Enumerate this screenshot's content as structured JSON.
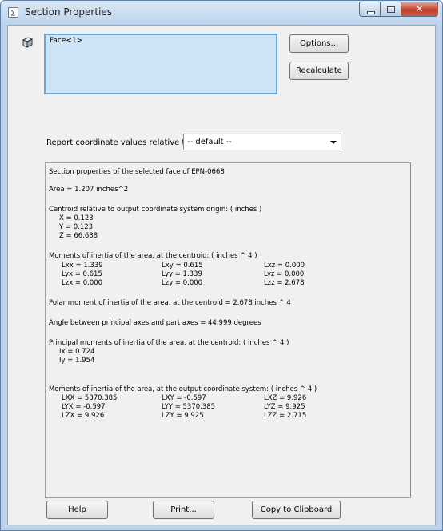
{
  "window": {
    "title": "Section Properties"
  },
  "selection": {
    "items": [
      "Face<1>"
    ]
  },
  "buttons": {
    "options": "Options...",
    "recalculate": "Recalculate",
    "help": "Help",
    "print": "Print...",
    "copy": "Copy to Clipboard"
  },
  "report": {
    "label": "Report coordinate values relative to:",
    "selected": "-- default --"
  },
  "results": {
    "header": "Section properties of the selected face of EPN-0668",
    "area": "Area = 1.207 inches^2",
    "centroid_title": "Centroid relative to output coordinate system origin: ( inches )",
    "centroid": [
      "X = 0.123",
      "Y = 0.123",
      "Z = 66.688"
    ],
    "moments_centroid_title": "Moments of inertia of the area, at the centroid: ( inches ^ 4 )",
    "moments_centroid": [
      [
        "Lxx = 1.339",
        "Lxy = 0.615",
        "Lxz = 0.000"
      ],
      [
        "Lyx = 0.615",
        "Lyy = 1.339",
        "Lyz = 0.000"
      ],
      [
        "Lzx = 0.000",
        "Lzy = 0.000",
        "Lzz = 2.678"
      ]
    ],
    "polar": "Polar moment of inertia of the area, at the centroid = 2.678 inches ^ 4",
    "angle": "Angle between principal axes and part axes = 44.999 degrees",
    "principal_title": "Principal moments of inertia of the area, at the centroid: ( inches ^ 4 )",
    "principal": [
      "Ix = 0.724",
      "Iy = 1.954"
    ],
    "moments_output_title": "Moments of inertia of the area, at the output coordinate system: ( inches ^ 4 )",
    "moments_output": [
      [
        "LXX = 5370.385",
        "LXY = -0.597",
        "LXZ = 9.926"
      ],
      [
        "LYX = -0.597",
        "LYY = 5370.385",
        "LYZ = 9.925"
      ],
      [
        "LZX = 9.926",
        "LZY = 9.925",
        "LZZ = 2.715"
      ]
    ]
  }
}
